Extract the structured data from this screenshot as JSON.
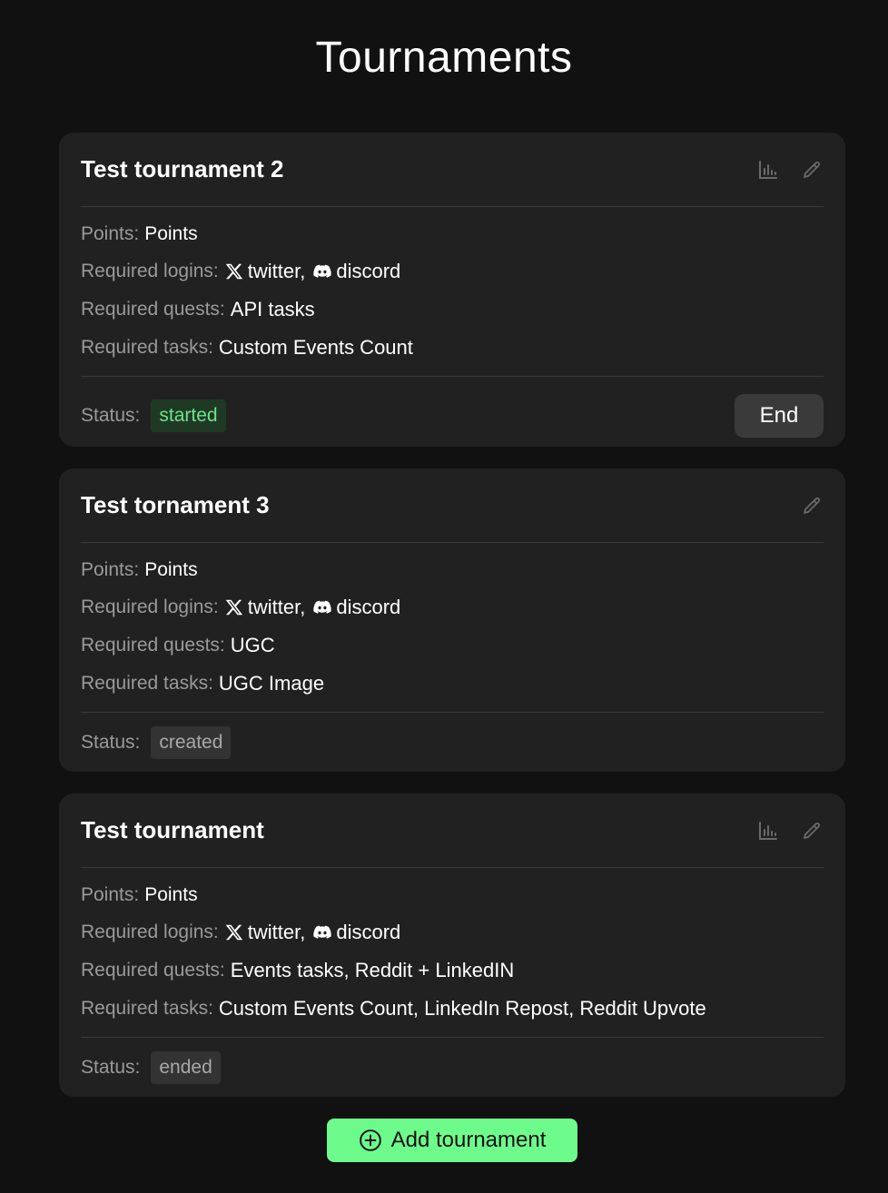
{
  "page": {
    "title": "Tournaments"
  },
  "labels": {
    "points": "Points:",
    "required_logins": "Required logins:",
    "required_quests": "Required quests:",
    "required_tasks": "Required tasks:",
    "status": "Status:"
  },
  "tournaments": [
    {
      "title": "Test tournament 2",
      "icons": [
        "bar-chart-icon",
        "edit-icon"
      ],
      "points": "Points",
      "logins": {
        "twitter": "twitter,",
        "discord": "discord"
      },
      "quests": "API tasks",
      "tasks": "Custom Events Count",
      "status": "started",
      "action_label": "End"
    },
    {
      "title": "Test tornament 3",
      "icons": [
        "edit-icon"
      ],
      "points": "Points",
      "logins": {
        "twitter": "twitter,",
        "discord": "discord"
      },
      "quests": "UGC",
      "tasks": "UGC Image",
      "status": "created"
    },
    {
      "title": "Test tournament",
      "icons": [
        "bar-chart-icon",
        "edit-icon"
      ],
      "points": "Points",
      "logins": {
        "twitter": "twitter,",
        "discord": "discord"
      },
      "quests": "Events tasks, Reddit + LinkedIN",
      "tasks": "Custom Events Count, LinkedIn Repost, Reddit Upvote",
      "status": "ended"
    }
  ],
  "add_button": {
    "label": "Add tournament",
    "icon": "plus-circle-icon"
  },
  "colors": {
    "background": "#111111",
    "card": "#212121",
    "accent_green": "#6dfc8c",
    "status_started_text": "#6ce38a"
  }
}
